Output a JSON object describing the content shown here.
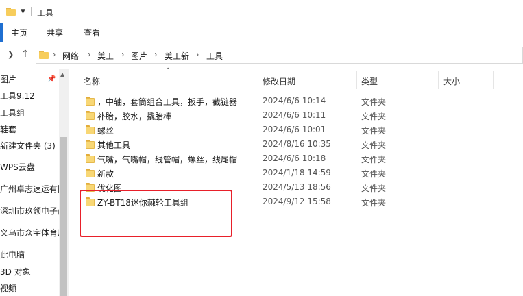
{
  "window": {
    "title": "工具"
  },
  "ribbon": {
    "tabs": [
      "主页",
      "共享",
      "查看"
    ]
  },
  "address": {
    "crumbs": [
      "网络",
      "美工",
      "图片",
      "美工新",
      "工具"
    ]
  },
  "nav": {
    "items": [
      "图片",
      "工具9.12",
      "工具组",
      "鞋套",
      "新建文件夹 (3)",
      "WPS云盘",
      "广州卓志速运有限",
      "深圳市玖领电子商",
      "义乌市众宇体育用",
      "此电脑",
      "3D 对象",
      "视频"
    ]
  },
  "columns": {
    "name": "名称",
    "date": "修改日期",
    "type": "类型",
    "size": "大小"
  },
  "files": [
    {
      "name": "，中轴，套筒组合工具，扳手，截链器",
      "date": "2024/6/6 10:14",
      "type": "文件夹"
    },
    {
      "name": "补胎，胶水，撬胎棒",
      "date": "2024/6/6 10:11",
      "type": "文件夹"
    },
    {
      "name": "螺丝",
      "date": "2024/6/6 10:01",
      "type": "文件夹"
    },
    {
      "name": "其他工具",
      "date": "2024/8/16 10:35",
      "type": "文件夹"
    },
    {
      "name": "气嘴，气嘴帽，线管帽，螺丝，线尾帽",
      "date": "2024/6/6 10:18",
      "type": "文件夹"
    },
    {
      "name": "新款",
      "date": "2024/1/18 14:59",
      "type": "文件夹"
    },
    {
      "name": "优化图",
      "date": "2024/5/13 18:56",
      "type": "文件夹"
    },
    {
      "name": "ZY-BT18迷你棘轮工具组",
      "date": "2024/9/12 15:58",
      "type": "文件夹"
    }
  ],
  "colors": {
    "highlight": "#e8202a",
    "folder": "#f8d775"
  }
}
